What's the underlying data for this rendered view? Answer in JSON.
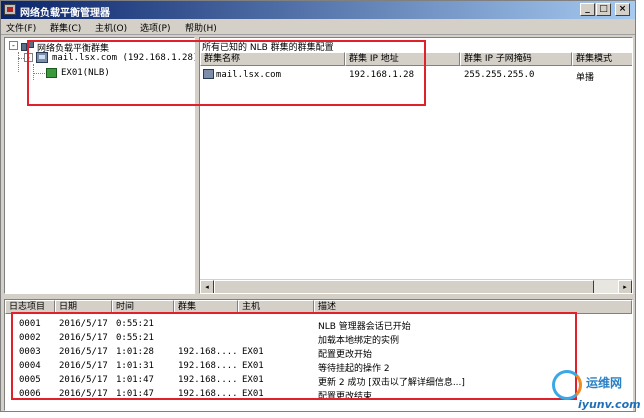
{
  "window": {
    "title": "网络负载平衡管理器"
  },
  "menubar": [
    "文件(F)",
    "群集(C)",
    "主机(O)",
    "选项(P)",
    "帮助(H)"
  ],
  "window_controls": {
    "minimize": "_",
    "maximize": "□",
    "close": "×"
  },
  "tree": {
    "root_label": "网络负载平衡群集",
    "root_expander": "-",
    "cluster_expander": "-",
    "cluster_label": "mail.lsx.com (192.168.1.28)",
    "host_label": "EX01(NLB)"
  },
  "list": {
    "caption": "所有已知的 NLB 群集的群集配置",
    "columns": [
      "群集名称",
      "群集 IP 地址",
      "群集 IP 子网掩码",
      "群集模式"
    ],
    "rows": [
      {
        "name": "mail.lsx.com",
        "ip": "192.168.1.28",
        "mask": "255.255.255.0",
        "mode": "单播"
      }
    ],
    "scroll_left": "◂",
    "scroll_right": "▸"
  },
  "log": {
    "columns": [
      "日志项目",
      "日期",
      "时间",
      "群集",
      "主机",
      "描述"
    ],
    "rows": [
      {
        "id": "0001",
        "date": "2016/5/17",
        "time": "0:55:21",
        "cluster": "",
        "host": "",
        "desc": "NLB 管理器会话已开始"
      },
      {
        "id": "0002",
        "date": "2016/5/17",
        "time": "0:55:21",
        "cluster": "",
        "host": "",
        "desc": "加载本地绑定的实例"
      },
      {
        "id": "0003",
        "date": "2016/5/17",
        "time": "1:01:28",
        "cluster": "192.168....",
        "host": "EX01",
        "desc": "配置更改开始"
      },
      {
        "id": "0004",
        "date": "2016/5/17",
        "time": "1:01:31",
        "cluster": "192.168....",
        "host": "EX01",
        "desc": "等待挂起的操作 2"
      },
      {
        "id": "0005",
        "date": "2016/5/17",
        "time": "1:01:47",
        "cluster": "192.168....",
        "host": "EX01",
        "desc": "更新 2 成功 [双击以了解详细信息...]"
      },
      {
        "id": "0006",
        "date": "2016/5/17",
        "time": "1:01:47",
        "cluster": "192.168....",
        "host": "EX01",
        "desc": "配置更改结束"
      }
    ]
  },
  "watermark": {
    "brand": "运维网",
    "site": "iyunv.com"
  },
  "colors": {
    "annotation": "#e0212b",
    "titlebar_start": "#0a246a",
    "titlebar_end": "#a6caf0"
  }
}
